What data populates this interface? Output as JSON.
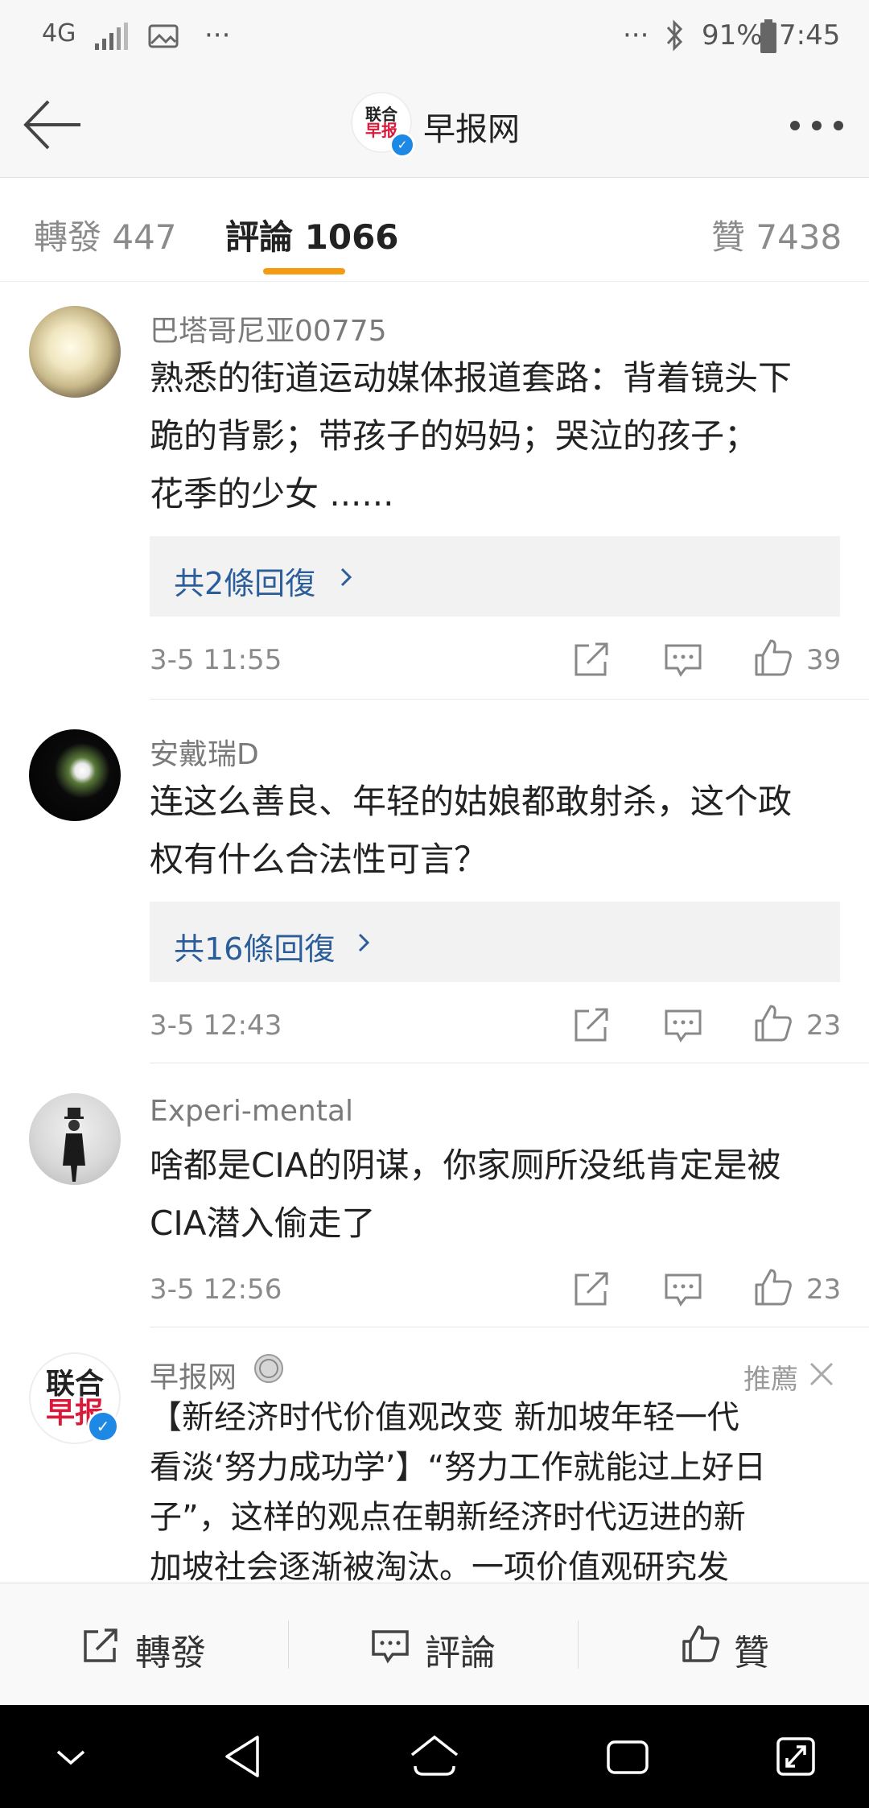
{
  "status_bar": {
    "network": "4G",
    "battery": "91%",
    "time": "7:45",
    "more_left": "···",
    "more_right": "···"
  },
  "header": {
    "title": "早报网",
    "logo_line1": "联合",
    "logo_line2": "早报"
  },
  "tabs": [
    {
      "label": "轉發 447"
    },
    {
      "label": "評論 1066"
    },
    {
      "label": "贊 7438"
    }
  ],
  "comments": [
    {
      "username": "巴塔哥尼亚00775",
      "text_lines": [
        "熟悉的街道运动媒体报道套路：背着镜头下",
        "跪的背影；带孩子的妈妈；哭泣的孩子；",
        "花季的少女 ......"
      ],
      "replies": "共2條回復",
      "time": "3-5 11:55",
      "likes": "39"
    },
    {
      "username": "安戴瑞D",
      "text_lines": [
        "连这么善良、年轻的姑娘都敢射杀，这个政",
        "权有什么合法性可言？"
      ],
      "replies": "共16條回復",
      "time": "3-5 12:43",
      "likes": "23"
    },
    {
      "username": "Experi-mental",
      "text_lines": [
        "啥都是CIA的阴谋，你家厕所没纸肯定是被",
        "CIA潜入偷走了"
      ],
      "replies": "",
      "time": "3-5 12:56",
      "likes": "23"
    },
    {
      "username": "早报网",
      "recommend": "推薦",
      "text_lines": [
        "【新经济时代价值观改变 新加坡年轻一代",
        "看淡‘努力成功学’】“努力工作就能过上好日",
        "子”，这样的观点在朝新经济时代迈进的新",
        "加坡社会逐渐被淘汰。一项价值观研究发"
      ]
    }
  ],
  "bottom_bar": {
    "repost": "轉發",
    "comment": "評論",
    "like": "贊"
  },
  "colors": {
    "accent": "#f39c12",
    "link": "#2a5d9a",
    "verified": "#1e88e5"
  }
}
